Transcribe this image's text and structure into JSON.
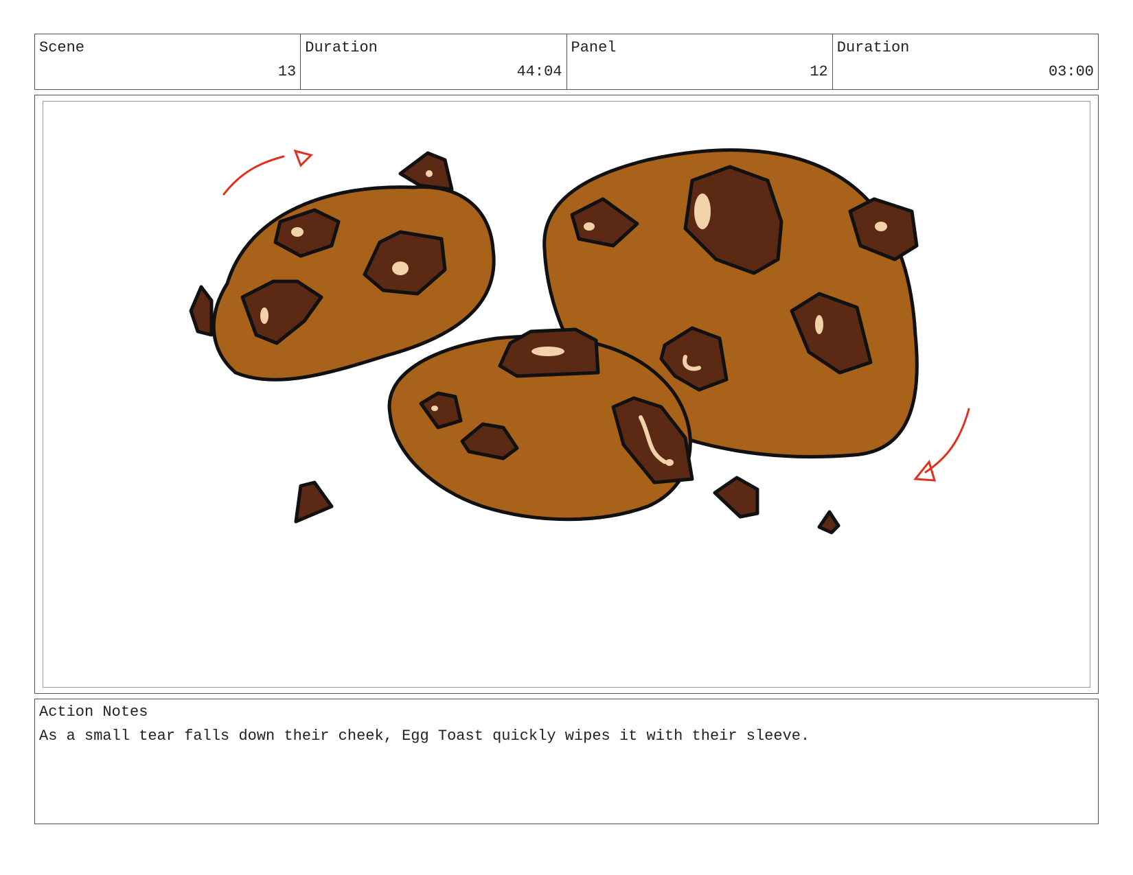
{
  "header": {
    "scene": {
      "label": "Scene",
      "value": "13"
    },
    "scene_duration": {
      "label": "Duration",
      "value": "44:04"
    },
    "panel": {
      "label": "Panel",
      "value": "12"
    },
    "panel_duration": {
      "label": "Duration",
      "value": "03:00"
    }
  },
  "artwork": {
    "subject": "cookies-icon",
    "colors": {
      "dough": "#a8621a",
      "chip": "#5c2a14",
      "highlight": "#f2d2a8",
      "outline": "#111111",
      "arrow": "#e0301c"
    }
  },
  "notes": {
    "label": "Action Notes",
    "text": "As a small tear falls down their cheek, Egg Toast quickly wipes it with their sleeve."
  }
}
